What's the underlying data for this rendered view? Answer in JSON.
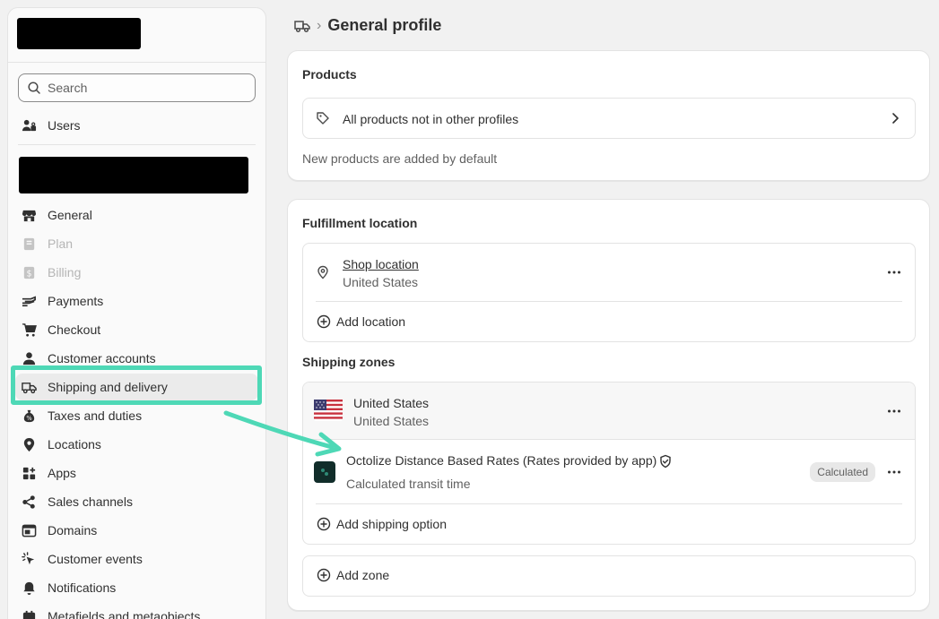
{
  "sidebar": {
    "search_placeholder": "Search",
    "users_label": "Users",
    "items": [
      {
        "label": "General",
        "icon": "store-icon",
        "disabled": false
      },
      {
        "label": "Plan",
        "icon": "plan-icon",
        "disabled": true
      },
      {
        "label": "Billing",
        "icon": "billing-icon",
        "disabled": true
      },
      {
        "label": "Payments",
        "icon": "payments-icon",
        "disabled": false
      },
      {
        "label": "Checkout",
        "icon": "cart-icon",
        "disabled": false
      },
      {
        "label": "Customer accounts",
        "icon": "person-icon",
        "disabled": false
      },
      {
        "label": "Shipping and delivery",
        "icon": "truck-icon",
        "disabled": false,
        "active": true
      },
      {
        "label": "Taxes and duties",
        "icon": "tax-icon",
        "disabled": false
      },
      {
        "label": "Locations",
        "icon": "location-icon",
        "disabled": false
      },
      {
        "label": "Apps",
        "icon": "apps-icon",
        "disabled": false
      },
      {
        "label": "Sales channels",
        "icon": "channels-icon",
        "disabled": false
      },
      {
        "label": "Domains",
        "icon": "domain-icon",
        "disabled": false
      },
      {
        "label": "Customer events",
        "icon": "events-icon",
        "disabled": false
      },
      {
        "label": "Notifications",
        "icon": "bell-icon",
        "disabled": false
      },
      {
        "label": "Metafields and metaobjects",
        "icon": "metafields-icon",
        "disabled": false
      }
    ]
  },
  "header": {
    "title": "General profile"
  },
  "products": {
    "title": "Products",
    "row_label": "All products not in other profiles",
    "note": "New products are added by default"
  },
  "fulfillment": {
    "title": "Fulfillment location",
    "location_name": "Shop location",
    "location_country": "United States",
    "add_location": "Add location"
  },
  "shipping_zones": {
    "title": "Shipping zones",
    "zone_name": "United States",
    "zone_country": "United States",
    "rate_name": "Octolize Distance Based Rates (Rates provided by app)",
    "rate_detail": "Calculated transit time",
    "rate_badge": "Calculated",
    "add_option": "Add shipping option",
    "add_zone": "Add zone"
  },
  "colors": {
    "highlight": "#4ed8b6",
    "accent_text": "#303030"
  }
}
